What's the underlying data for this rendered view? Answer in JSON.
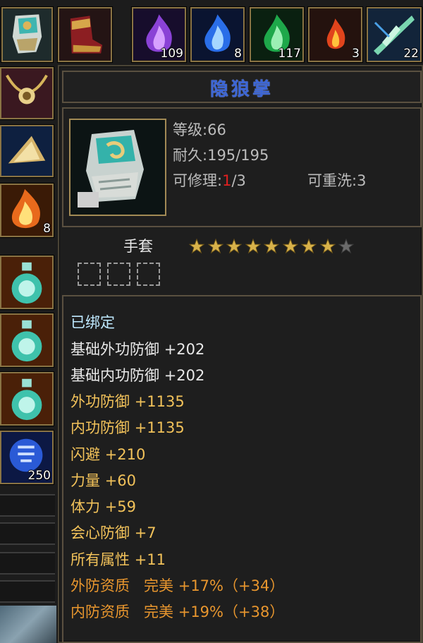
{
  "item": {
    "name": "隐狼掌",
    "level_label": "等级",
    "level": "66",
    "durability_label": "耐久",
    "durability": "195/195",
    "repair_label": "可修理",
    "repair_current": "1",
    "repair_max": "/3",
    "rewash_label": "可重洗",
    "rewash": "3",
    "type": "手套",
    "stars_filled": 8,
    "stars_total": 9,
    "gem_slots": 3
  },
  "attributes": {
    "bound": "已绑定",
    "base_ext_def": "基础外功防御",
    "base_ext_def_val": "+202",
    "base_int_def": "基础内功防御",
    "base_int_def_val": "+202",
    "ext_def": "外功防御",
    "ext_def_val": "+1135",
    "int_def": "内功防御",
    "int_def_val": "+1135",
    "dodge": "闪避",
    "dodge_val": "+210",
    "strength": "力量",
    "strength_val": "+60",
    "stamina": "体力",
    "stamina_val": "+59",
    "crit_def": "会心防御",
    "crit_def_val": "+7",
    "all_attr": "所有属性",
    "all_attr_val": "+11",
    "ext_quality": "外防资质",
    "ext_quality_grade": "完美",
    "ext_quality_val": "+17%",
    "ext_quality_bonus": "（+34）",
    "int_quality": "内防资质",
    "int_quality_grade": "完美",
    "int_quality_val": "+19%",
    "int_quality_bonus": "（+38）"
  },
  "top_bar": {
    "purple_flame_count": "109",
    "blue_flame_count": "8",
    "green_flame_count": "117",
    "red_flame_count": "3",
    "feather_count": "22"
  },
  "side_bar": {
    "fire_count": "8",
    "scroll_count": "250"
  },
  "colors": {
    "frame_gold": "#a28a55",
    "title_blue": "#3c66d6",
    "attr_yellow": "#f2c25a",
    "quality_orange": "#e8962e",
    "repair_red": "#e02020"
  }
}
